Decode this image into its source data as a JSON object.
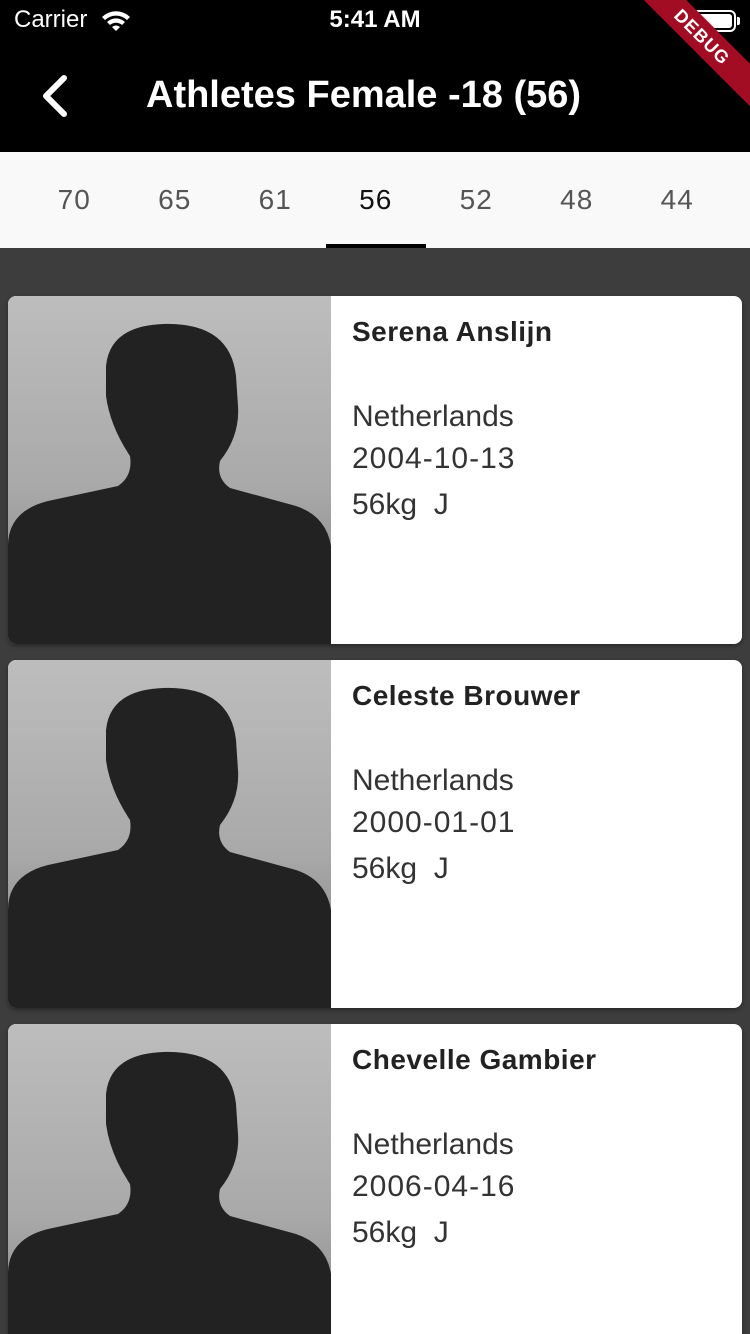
{
  "status_bar": {
    "carrier": "Carrier",
    "time": "5:41 AM"
  },
  "app_bar": {
    "title": "Athletes Female -18 (56)",
    "debug_label": "DEBUG"
  },
  "tabs": [
    {
      "label": "70"
    },
    {
      "label": "65"
    },
    {
      "label": "61"
    },
    {
      "label": "56",
      "active": true
    },
    {
      "label": "52"
    },
    {
      "label": "48"
    },
    {
      "label": "44"
    }
  ],
  "athletes": [
    {
      "name": "Serena Anslijn",
      "country": "Netherlands",
      "birthdate": "2004-10-13",
      "weight_class": "56kg  J"
    },
    {
      "name": "Celeste Brouwer",
      "country": "Netherlands",
      "birthdate": "2000-01-01",
      "weight_class": "56kg  J"
    },
    {
      "name": "Chevelle Gambier",
      "country": "Netherlands",
      "birthdate": "2006-04-16",
      "weight_class": "56kg  J"
    }
  ],
  "icons": {
    "back": "chevron-left-icon",
    "wifi": "wifi-icon",
    "battery": "battery-icon",
    "photo": "person-silhouette-icon"
  },
  "colors": {
    "app_bar": "#000000",
    "background": "#3d3d3d",
    "tab_bar": "#f9f9f9",
    "debug_ribbon": "#a30d24"
  }
}
